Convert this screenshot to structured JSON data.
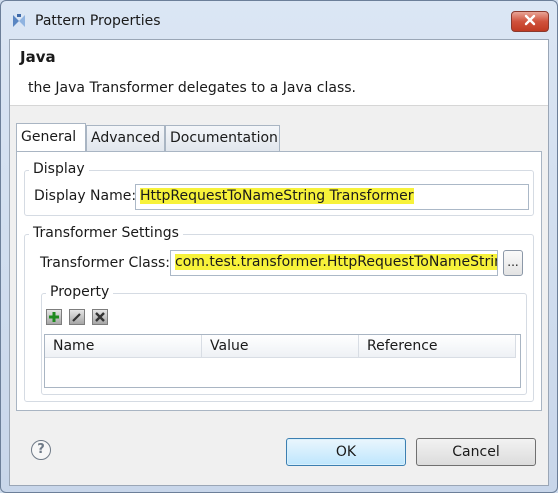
{
  "window": {
    "title": "Pattern Properties"
  },
  "header": {
    "title": "Java",
    "description": "the Java Transformer delegates to a Java class."
  },
  "tabs": [
    {
      "label": "General",
      "active": true
    },
    {
      "label": "Advanced",
      "active": false
    },
    {
      "label": "Documentation",
      "active": false
    }
  ],
  "display_group": {
    "label": "Display",
    "display_name_label": "Display Name:",
    "display_name_value": "HttpRequestToNameString Transformer"
  },
  "transformer_group": {
    "label": "Transformer Settings",
    "class_label": "Transformer Class:",
    "class_value": "com.test.transformer.HttpRequestToNameString",
    "browse_label": "..."
  },
  "property_group": {
    "label": "Property",
    "columns": [
      "Name",
      "Value",
      "Reference"
    ],
    "rows": []
  },
  "footer": {
    "help_glyph": "?",
    "ok_label": "OK",
    "cancel_label": "Cancel"
  },
  "colors": {
    "highlight": "#f7f23a",
    "close_button": "#d0523c",
    "default_button": "#bee6fd"
  },
  "icons": {
    "app": "pattern-icon",
    "close": "close-icon",
    "add": "add-icon",
    "edit": "edit-icon",
    "delete": "delete-icon",
    "help": "help-icon"
  }
}
